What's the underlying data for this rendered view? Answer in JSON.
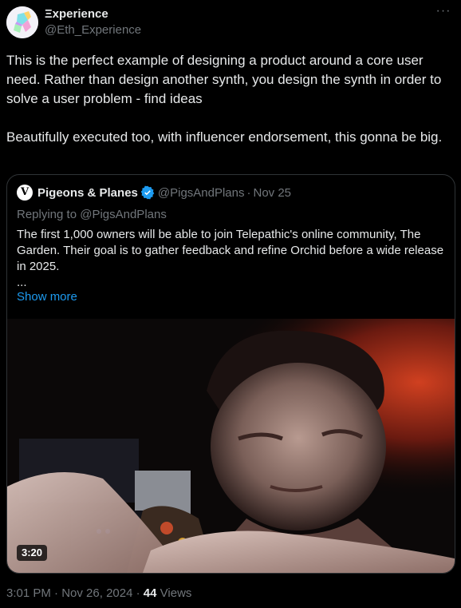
{
  "author": {
    "display_name": "Ξxperience",
    "handle": "@Eth_Experience"
  },
  "more_icon": "more-horizontal-icon",
  "tweet": {
    "paragraphs": [
      "This is the perfect example of designing a product around a core user need. Rather than design another synth, you design the synth in order to solve a user problem - find ideas",
      "Beautifully executed too, with influencer endorsement, this gonna be big."
    ]
  },
  "quote": {
    "avatar_glyph": "V",
    "name": "Pigeons & Planes",
    "verified_icon": "verified-badge-icon",
    "handle": "@PigsAndPlans",
    "separator": "·",
    "date": "Nov 25",
    "replying_to": "Replying to @PigsAndPlans",
    "text": "The first 1,000 owners will be able to join Telepathic's online community, The Garden. Their goal is to gather feedback and refine Orchid before a wide release in 2025.",
    "ellipsis": "...",
    "show_more": "Show more",
    "video_duration": "3:20"
  },
  "meta": {
    "time": "3:01 PM",
    "separator": "·",
    "date": "Nov 26, 2024",
    "views_count": "44",
    "views_label": "Views"
  },
  "colors": {
    "background": "#000000",
    "text_primary": "#e7e9ea",
    "text_secondary": "#71767b",
    "link": "#1d9bf0",
    "border": "#2f3336",
    "verified": "#1d9bf0"
  }
}
